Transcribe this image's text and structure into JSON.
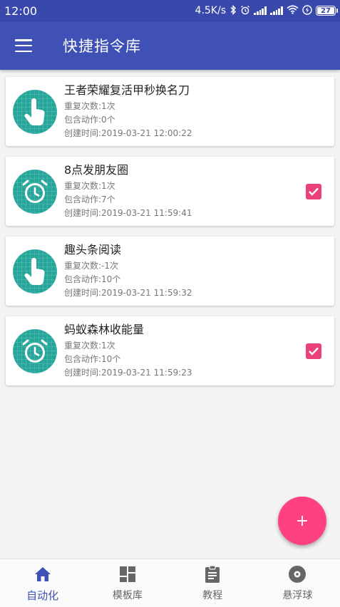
{
  "status_bar": {
    "time": "12:00",
    "speed": "4.5K/s",
    "battery": "27"
  },
  "app_bar": {
    "title": "快捷指令库"
  },
  "items": [
    {
      "title": "王者荣耀复活甲秒换名刀",
      "repeat": "重复次数:1次",
      "actions": "包含动作:0个",
      "created": "创建时间:2019-03-21 12:00:22",
      "icon": "touch-icon",
      "checked": false
    },
    {
      "title": "8点发朋友圈",
      "repeat": "重复次数:1次",
      "actions": "包含动作:7个",
      "created": "创建时间:2019-03-21 11:59:41",
      "icon": "alarm-clock-icon",
      "checked": true
    },
    {
      "title": "趣头条阅读",
      "repeat": "重复次数:-1次",
      "actions": "包含动作:10个",
      "created": "创建时间:2019-03-21 11:59:32",
      "icon": "touch-icon",
      "checked": false
    },
    {
      "title": "蚂蚁森林收能量",
      "repeat": "重复次数:1次",
      "actions": "包含动作:10个",
      "created": "创建时间:2019-03-21 11:59:23",
      "icon": "alarm-clock-icon",
      "checked": true
    }
  ],
  "fab": {
    "label": "+"
  },
  "bottom_nav": [
    {
      "label": "自动化",
      "icon": "home-icon",
      "active": true
    },
    {
      "label": "模板库",
      "icon": "dashboard-icon",
      "active": false
    },
    {
      "label": "教程",
      "icon": "clipboard-icon",
      "active": false
    },
    {
      "label": "悬浮球",
      "icon": "disc-icon",
      "active": false
    }
  ],
  "colors": {
    "primary": "#3f51b5",
    "status_bar": "#3849ab",
    "icon_circle": "#26a69a",
    "accent": "#ff4081",
    "checkbox": "#ec407a"
  }
}
